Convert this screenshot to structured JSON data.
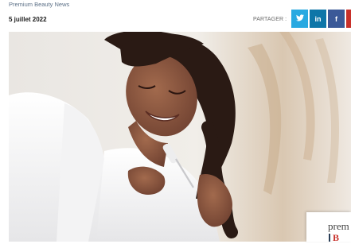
{
  "article": {
    "source": "Premium Beauty News",
    "date": "5 juillet 2022"
  },
  "share": {
    "label": "PARTAGER :",
    "buttons": [
      {
        "icon": "twitter-icon",
        "glyph": "✉",
        "color": "#29a9e1"
      },
      {
        "icon": "linkedin-icon",
        "glyph": "in",
        "color": "#0e76a8"
      },
      {
        "icon": "facebook-icon",
        "glyph": "f",
        "color": "#3b5998"
      },
      {
        "icon": "share-more-icon",
        "glyph": "",
        "color": "#c8302a"
      }
    ]
  },
  "hero_image": {
    "alt": "Woman applying serum to curly hair"
  },
  "brand_card": {
    "line1": "prem",
    "line2": "B"
  }
}
